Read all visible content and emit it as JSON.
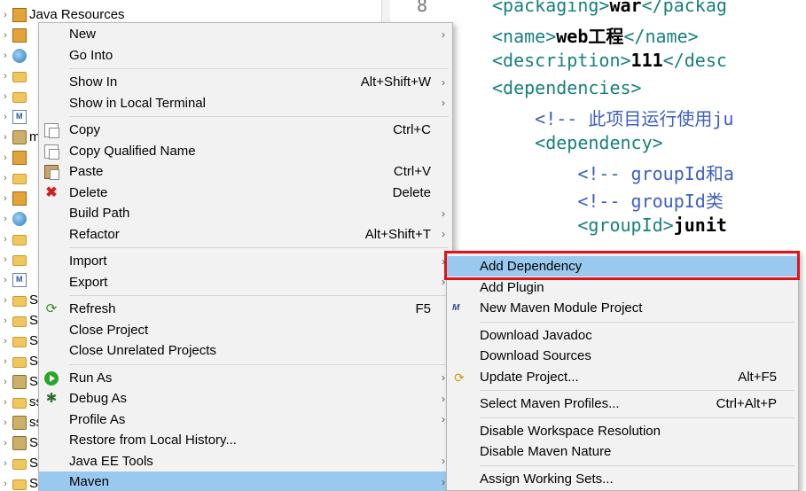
{
  "explorer": {
    "rows": [
      {
        "label": "Java Resources",
        "icon": "java-resources-icon"
      },
      {
        "label": "",
        "icon": "library-icon"
      },
      {
        "label": "",
        "icon": "web-resources-icon"
      },
      {
        "label": "",
        "icon": "folder-icon"
      },
      {
        "label": "",
        "icon": "folder-icon"
      },
      {
        "label": "",
        "icon": "pom-xml-icon"
      },
      {
        "label": "ma",
        "icon": "maven-project-icon"
      },
      {
        "label": "",
        "icon": "jar-icon"
      },
      {
        "label": "",
        "icon": "folder-icon"
      },
      {
        "label": "",
        "icon": "library-icon"
      },
      {
        "label": "",
        "icon": "web-resources-icon"
      },
      {
        "label": "",
        "icon": "folder-icon"
      },
      {
        "label": "",
        "icon": "folder-icon"
      },
      {
        "label": "",
        "icon": "pom-xml-icon"
      },
      {
        "label": "Ser",
        "icon": "folder-icon"
      },
      {
        "label": "Spr",
        "icon": "folder-icon"
      },
      {
        "label": "Spr",
        "icon": "folder-icon"
      },
      {
        "label": "Spr",
        "icon": "folder-icon"
      },
      {
        "label": "Spr",
        "icon": "project-icon"
      },
      {
        "label": "ssh",
        "icon": "folder-icon"
      },
      {
        "label": "ssh",
        "icon": "project-icon"
      },
      {
        "label": "Str",
        "icon": "project-icon"
      },
      {
        "label": "Str",
        "icon": "folder-icon"
      },
      {
        "label": "Str",
        "icon": "folder-icon"
      }
    ]
  },
  "editor": {
    "line_number": "8",
    "lines": [
      {
        "parts": [
          {
            "t": "tag",
            "v": "<packaging>"
          },
          {
            "t": "txt",
            "v": "war"
          },
          {
            "t": "tag",
            "v": "</packag"
          }
        ]
      },
      {
        "parts": [
          {
            "t": "tag",
            "v": "<name>"
          },
          {
            "t": "txt",
            "v": "web工程"
          },
          {
            "t": "tag",
            "v": "</name>"
          }
        ]
      },
      {
        "parts": [
          {
            "t": "tag",
            "v": "<description>"
          },
          {
            "t": "txt",
            "v": "111"
          },
          {
            "t": "tag",
            "v": "</desc"
          }
        ]
      },
      {
        "parts": [
          {
            "t": "tag",
            "v": "<dependencies>"
          }
        ]
      },
      {
        "parts": [
          {
            "t": "cmt",
            "v": "    <!-- 此项目运行使用ju"
          }
        ]
      },
      {
        "parts": [
          {
            "t": "tag",
            "v": "    <dependency>"
          }
        ]
      },
      {
        "parts": [
          {
            "t": "cmt",
            "v": "        <!-- groupId和a"
          }
        ]
      },
      {
        "parts": [
          {
            "t": "cmt",
            "v": "        <!-- groupId类"
          }
        ]
      },
      {
        "parts": [
          {
            "t": "tag",
            "v": "        <groupId>"
          },
          {
            "t": "txt",
            "v": "junit"
          }
        ]
      }
    ]
  },
  "main_menu": {
    "items": [
      {
        "label": "New",
        "shortcut": "",
        "submenu": true,
        "icon": ""
      },
      {
        "label": "Go Into",
        "shortcut": "",
        "submenu": false,
        "icon": ""
      },
      {
        "sep": true
      },
      {
        "label": "Show In",
        "shortcut": "Alt+Shift+W",
        "submenu": true,
        "icon": ""
      },
      {
        "label": "Show in Local Terminal",
        "shortcut": "",
        "submenu": true,
        "icon": ""
      },
      {
        "sep": true
      },
      {
        "label": "Copy",
        "shortcut": "Ctrl+C",
        "submenu": false,
        "icon": "copy-icon"
      },
      {
        "label": "Copy Qualified Name",
        "shortcut": "",
        "submenu": false,
        "icon": "copy-qualified-icon"
      },
      {
        "label": "Paste",
        "shortcut": "Ctrl+V",
        "submenu": false,
        "icon": "paste-icon"
      },
      {
        "label": "Delete",
        "shortcut": "Delete",
        "submenu": false,
        "icon": "delete-icon"
      },
      {
        "label": "Build Path",
        "shortcut": "",
        "submenu": true,
        "icon": ""
      },
      {
        "label": "Refactor",
        "shortcut": "Alt+Shift+T",
        "submenu": true,
        "icon": ""
      },
      {
        "sep": true
      },
      {
        "label": "Import",
        "shortcut": "",
        "submenu": true,
        "icon": ""
      },
      {
        "label": "Export",
        "shortcut": "",
        "submenu": true,
        "icon": ""
      },
      {
        "sep": true
      },
      {
        "label": "Refresh",
        "shortcut": "F5",
        "submenu": false,
        "icon": "refresh-icon"
      },
      {
        "label": "Close Project",
        "shortcut": "",
        "submenu": false,
        "icon": ""
      },
      {
        "label": "Close Unrelated Projects",
        "shortcut": "",
        "submenu": false,
        "icon": ""
      },
      {
        "sep": true
      },
      {
        "label": "Run As",
        "shortcut": "",
        "submenu": true,
        "icon": "run-icon"
      },
      {
        "label": "Debug As",
        "shortcut": "",
        "submenu": true,
        "icon": "debug-icon"
      },
      {
        "label": "Profile As",
        "shortcut": "",
        "submenu": true,
        "icon": ""
      },
      {
        "label": "Restore from Local History...",
        "shortcut": "",
        "submenu": false,
        "icon": ""
      },
      {
        "label": "Java EE Tools",
        "shortcut": "",
        "submenu": true,
        "icon": ""
      },
      {
        "label": "Maven",
        "shortcut": "",
        "submenu": true,
        "icon": "",
        "selected": true
      }
    ]
  },
  "maven_menu": {
    "items": [
      {
        "label": "Add Dependency",
        "shortcut": "",
        "icon": "",
        "selected": true
      },
      {
        "label": "Add Plugin",
        "shortcut": "",
        "icon": ""
      },
      {
        "label": "New Maven Module Project",
        "shortcut": "",
        "icon": "maven-module-icon"
      },
      {
        "sep": true
      },
      {
        "label": "Download Javadoc",
        "shortcut": "",
        "icon": ""
      },
      {
        "label": "Download Sources",
        "shortcut": "",
        "icon": ""
      },
      {
        "label": "Update Project...",
        "shortcut": "Alt+F5",
        "icon": "update-project-icon"
      },
      {
        "sep": true
      },
      {
        "label": "Select Maven Profiles...",
        "shortcut": "Ctrl+Alt+P",
        "icon": ""
      },
      {
        "sep": true
      },
      {
        "label": "Disable Workspace Resolution",
        "shortcut": "",
        "icon": ""
      },
      {
        "label": "Disable Maven Nature",
        "shortcut": "",
        "icon": ""
      },
      {
        "sep": true
      },
      {
        "label": "Assign Working Sets...",
        "shortcut": "",
        "icon": ""
      }
    ]
  },
  "colors": {
    "selection": "#99c9ef",
    "highlight_border": "#e0121b",
    "xml_tag": "#17807d",
    "comment": "#3f5fbf"
  }
}
